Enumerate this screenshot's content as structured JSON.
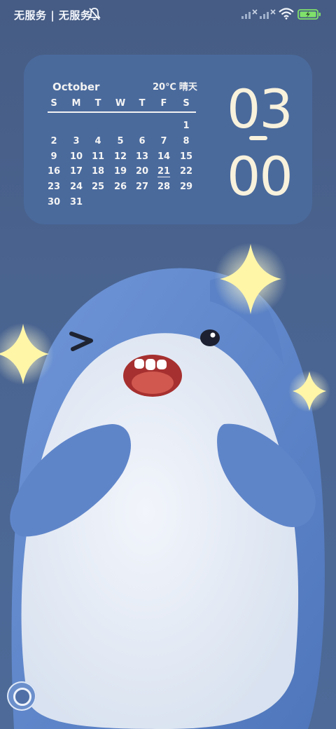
{
  "status_bar": {
    "carrier_text": "无服务 | 无服务",
    "icons": [
      "bell-muted-icon",
      "signal-x-icon",
      "signal-x-icon",
      "wifi-icon",
      "battery-charging-icon"
    ],
    "battery_color": "#7fe06a"
  },
  "widget": {
    "month": "October",
    "temperature": "20℃",
    "weather": "晴天",
    "weekdays": [
      "S",
      "M",
      "T",
      "W",
      "T",
      "F",
      "S"
    ],
    "weeks": [
      [
        "",
        "",
        "",
        "",
        "",
        "",
        "1"
      ],
      [
        "2",
        "3",
        "4",
        "5",
        "6",
        "7",
        "8"
      ],
      [
        "9",
        "10",
        "11",
        "12",
        "13",
        "14",
        "15"
      ],
      [
        "16",
        "17",
        "18",
        "19",
        "20",
        "21",
        "22"
      ],
      [
        "23",
        "24",
        "25",
        "26",
        "27",
        "28",
        "29"
      ],
      [
        "30",
        "31",
        "",
        "",
        "",
        "",
        ""
      ]
    ],
    "today": "21",
    "clock_hour": "03",
    "clock_minute": "00",
    "accent_color": "#f8f1dc"
  },
  "wallpaper": {
    "subject": "shark-plush-icon",
    "sparkle_icons": [
      "sparkle-icon",
      "sparkle-icon",
      "sparkle-icon"
    ]
  },
  "home_button": {
    "icon": "assistive-touch-icon"
  }
}
